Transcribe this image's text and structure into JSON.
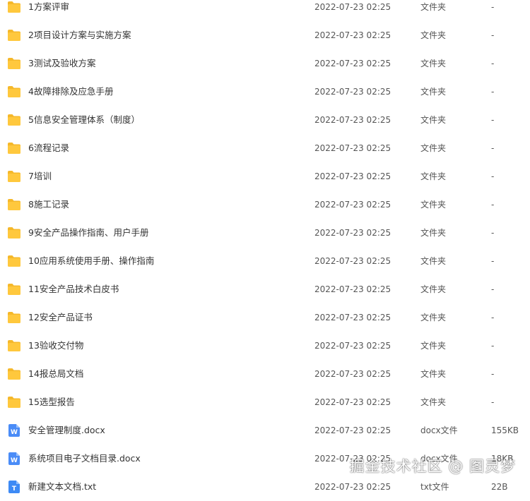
{
  "colors": {
    "folder": "#FFC83D",
    "folder_tab": "#F5B82A",
    "word_icon": "#4A8CF7",
    "text_icon": "#3D8AF5"
  },
  "files": [
    {
      "name": "1方案评审",
      "date": "2022-07-23 02:25",
      "type": "文件夹",
      "size": "-",
      "icon": "folder-icon"
    },
    {
      "name": "2项目设计方案与实施方案",
      "date": "2022-07-23 02:25",
      "type": "文件夹",
      "size": "-",
      "icon": "folder-icon"
    },
    {
      "name": "3测试及验收方案",
      "date": "2022-07-23 02:25",
      "type": "文件夹",
      "size": "-",
      "icon": "folder-icon"
    },
    {
      "name": "4故障排除及应急手册",
      "date": "2022-07-23 02:25",
      "type": "文件夹",
      "size": "-",
      "icon": "folder-icon"
    },
    {
      "name": "5信息安全管理体系（制度）",
      "date": "2022-07-23 02:25",
      "type": "文件夹",
      "size": "-",
      "icon": "folder-icon"
    },
    {
      "name": "6流程记录",
      "date": "2022-07-23 02:25",
      "type": "文件夹",
      "size": "-",
      "icon": "folder-icon"
    },
    {
      "name": "7培训",
      "date": "2022-07-23 02:25",
      "type": "文件夹",
      "size": "-",
      "icon": "folder-icon"
    },
    {
      "name": "8施工记录",
      "date": "2022-07-23 02:25",
      "type": "文件夹",
      "size": "-",
      "icon": "folder-icon"
    },
    {
      "name": "9安全产品操作指南、用户手册",
      "date": "2022-07-23 02:25",
      "type": "文件夹",
      "size": "-",
      "icon": "folder-icon"
    },
    {
      "name": "10应用系统使用手册、操作指南",
      "date": "2022-07-23 02:25",
      "type": "文件夹",
      "size": "-",
      "icon": "folder-icon"
    },
    {
      "name": "11安全产品技术白皮书",
      "date": "2022-07-23 02:25",
      "type": "文件夹",
      "size": "-",
      "icon": "folder-icon"
    },
    {
      "name": "12安全产品证书",
      "date": "2022-07-23 02:25",
      "type": "文件夹",
      "size": "-",
      "icon": "folder-icon"
    },
    {
      "name": "13验收交付物",
      "date": "2022-07-23 02:25",
      "type": "文件夹",
      "size": "-",
      "icon": "folder-icon"
    },
    {
      "name": "14报总局文档",
      "date": "2022-07-23 02:25",
      "type": "文件夹",
      "size": "-",
      "icon": "folder-icon"
    },
    {
      "name": "15选型报告",
      "date": "2022-07-23 02:25",
      "type": "文件夹",
      "size": "-",
      "icon": "folder-icon"
    },
    {
      "name": "安全管理制度.docx",
      "date": "2022-07-23 02:25",
      "type": "docx文件",
      "size": "155KB",
      "icon": "word-doc-icon",
      "glyph": "W"
    },
    {
      "name": "系统项目电子文档目录.docx",
      "date": "2022-07-23 02:25",
      "type": "docx文件",
      "size": "18KB",
      "icon": "word-doc-icon",
      "glyph": "W"
    },
    {
      "name": "新建文本文档.txt",
      "date": "2022-07-23 02:25",
      "type": "txt文件",
      "size": "22B",
      "icon": "text-doc-icon",
      "glyph": "T"
    }
  ],
  "watermark": "掘金技术社区 @ 图灵梦"
}
